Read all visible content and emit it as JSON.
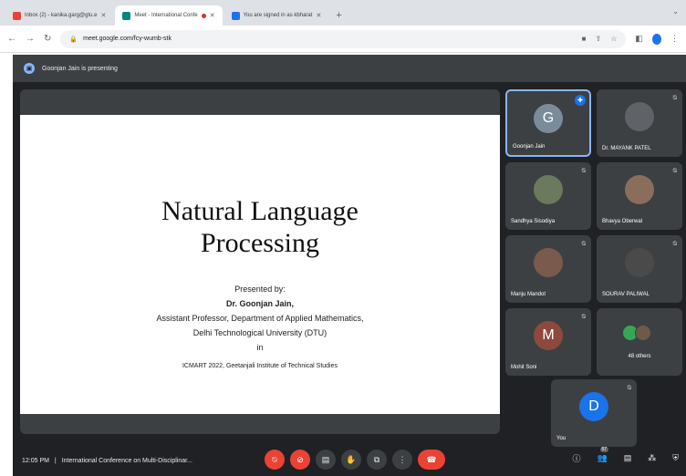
{
  "browser": {
    "tabs": [
      {
        "title": "Inbox (2) - kanika.garg@gtu.e",
        "favicon_color": "#ea4335",
        "active": false
      },
      {
        "title": "Meet - International Confe",
        "favicon_color": "#00897b",
        "active": true,
        "recording": true
      },
      {
        "title": "You are signed in as kbharat",
        "favicon_color": "#1a73e8",
        "active": false
      }
    ],
    "new_tab_label": "+",
    "url": "meet.google.com/fcy-wumb-stk"
  },
  "meet": {
    "presenting_text": "Goonjan Jain is presenting",
    "slide": {
      "title_line1": "Natural Language",
      "title_line2": "Processing",
      "presented_by": "Presented by:",
      "presenter": "Dr. Goonjan Jain,",
      "role": "Assistant Professor, Department of Applied Mathematics,",
      "university": "Delhi Technological University (DTU)",
      "in": "in",
      "event": "ICMART 2022, Geetanjali Institute of Technical Studies"
    },
    "participants": [
      {
        "name": "Goonjan Jain",
        "initial": "G",
        "color": "#7a8c9a"
      },
      {
        "name": "Dr. MAYANK PATEL",
        "initial": "",
        "color": "#5f6368"
      },
      {
        "name": "Sandhya Sisodiya",
        "initial": "",
        "color": "#6b7a5c"
      },
      {
        "name": "Bhavya Oberwal",
        "initial": "",
        "color": "#8a6d5a"
      },
      {
        "name": "Manju Mandot",
        "initial": "",
        "color": "#7a5a4d"
      },
      {
        "name": "SOURAV PALIWAL",
        "initial": "",
        "color": "#4a4a4a"
      },
      {
        "name": "Mohit Soni",
        "initial": "M",
        "color": "#8d4a3c"
      },
      {
        "name": "48 others",
        "initial": "",
        "color": "#3c4043"
      },
      {
        "name": "You",
        "initial": "D",
        "color": "#1a73e8"
      }
    ],
    "bottom": {
      "time": "12:05 PM",
      "separator": "|",
      "meeting_title": "International Conference on Multi-Disciplinar..."
    },
    "people_count": "57"
  }
}
